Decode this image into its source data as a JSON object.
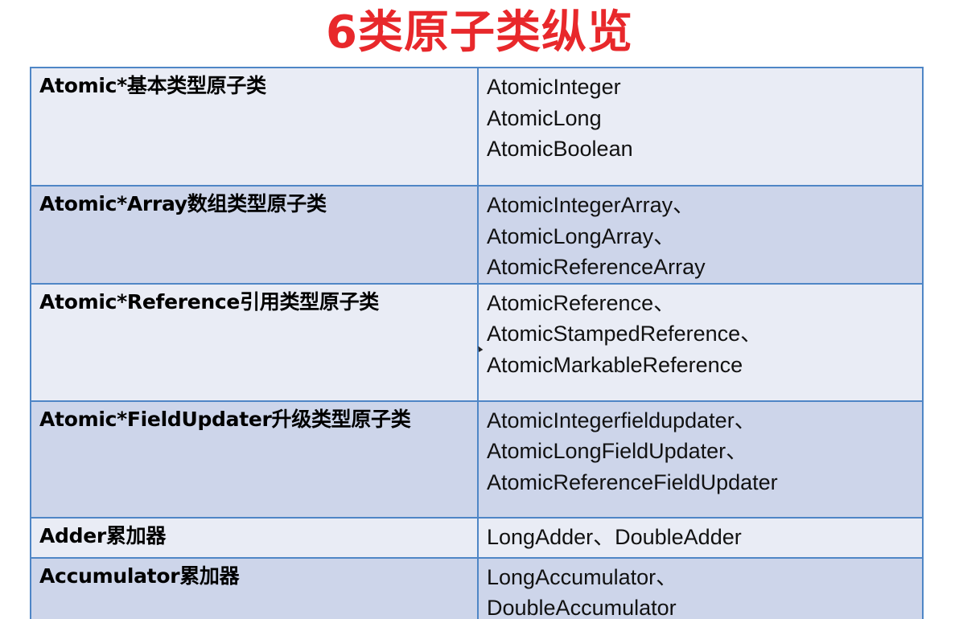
{
  "title": "6类原子类纵览",
  "rows": [
    {
      "category": "Atomic*基本类型原子类",
      "classes": [
        "AtomicInteger",
        "AtomicLong",
        "AtomicBoolean"
      ]
    },
    {
      "category": "Atomic*Array数组类型原子类",
      "classes": [
        "AtomicIntegerArray、",
        "AtomicLongArray、",
        "AtomicReferenceArray"
      ]
    },
    {
      "category": "Atomic*Reference引用类型原子类",
      "classes": [
        "AtomicReference、",
        "AtomicStampedReference、",
        "AtomicMarkableReference"
      ]
    },
    {
      "category": "Atomic*FieldUpdater升级类型原子类",
      "classes": [
        "AtomicIntegerfieldupdater、",
        "AtomicLongFieldUpdater、",
        "AtomicReferenceFieldUpdater"
      ]
    },
    {
      "category": "Adder累加器",
      "classes": [
        "LongAdder、DoubleAdder"
      ]
    },
    {
      "category": "Accumulator累加器",
      "classes": [
        "LongAccumulator、",
        "DoubleAccumulator"
      ]
    }
  ],
  "colors": {
    "title": "#e8282b",
    "border": "#4f86c6",
    "row_light": "#e9ecf5",
    "row_dark": "#cdd5ea"
  }
}
